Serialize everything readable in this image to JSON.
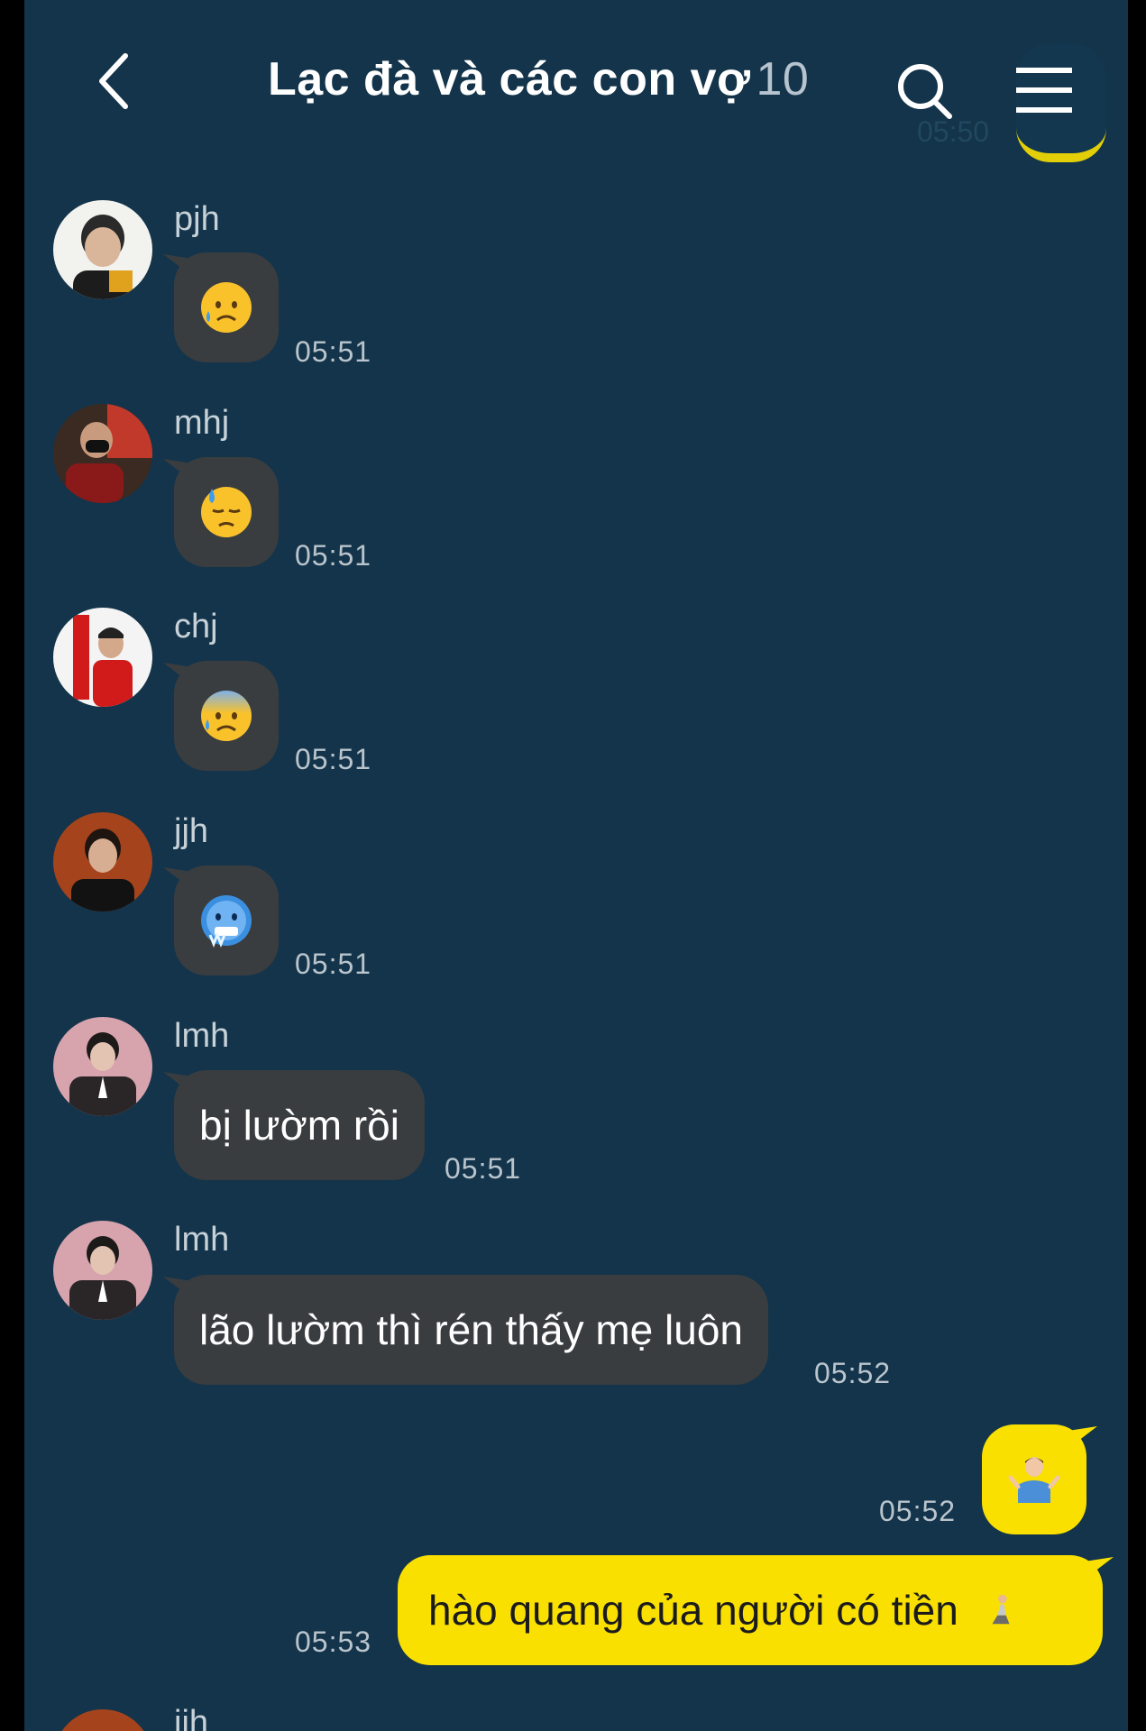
{
  "header": {
    "title": "Lạc đà và các con vợ",
    "member_count": "10",
    "back_icon": "chevron-left-icon",
    "search_icon": "search-icon",
    "menu_icon": "hamburger-menu-icon",
    "partial_time": "05:50"
  },
  "colors": {
    "background": "#13344a",
    "incoming_bubble": "#3a3d40",
    "outgoing_bubble": "#f9e000",
    "timestamp": "#b9c4cc"
  },
  "messages": [
    {
      "sender": "pjh",
      "content": "sad-relieved-face-emoji",
      "time": "05:51",
      "type": "emoji"
    },
    {
      "sender": "mhj",
      "content": "downcast-face-with-sweat-emoji",
      "time": "05:51",
      "type": "emoji"
    },
    {
      "sender": "chj",
      "content": "anxious-face-with-sweat-emoji",
      "time": "05:51",
      "type": "emoji"
    },
    {
      "sender": "jjh",
      "content": "cold-face-emoji",
      "time": "05:51",
      "type": "emoji"
    },
    {
      "sender": "lmh",
      "content": "bị lườm rồi",
      "time": "05:51",
      "type": "text"
    },
    {
      "sender": "lmh",
      "content": "lão lườm thì rén thấy mẹ luôn",
      "time": "05:52",
      "type": "text"
    },
    {
      "sender": "me",
      "content": "person-shrugging-emoji",
      "time": "05:52",
      "type": "emoji"
    },
    {
      "sender": "me",
      "content": "hào quang của người có tiền",
      "inline_icon": "person-kneeling-emoji",
      "time": "05:53",
      "type": "text"
    }
  ],
  "partial_next_sender": "jjh"
}
